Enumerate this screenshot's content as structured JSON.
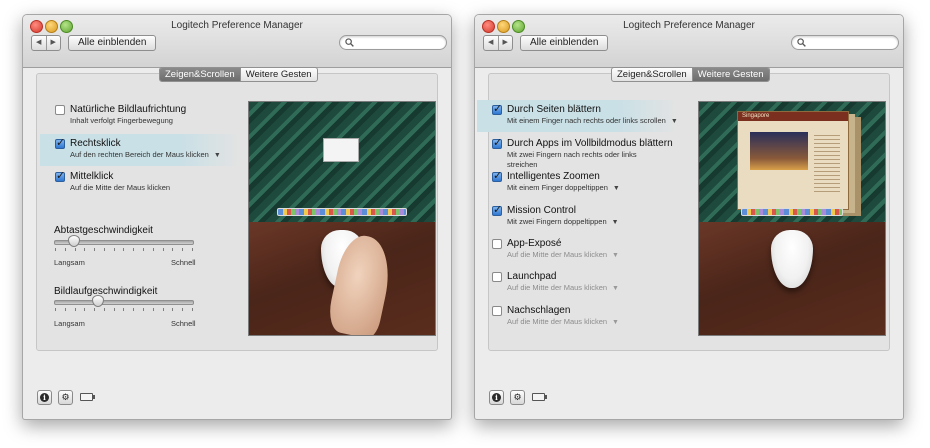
{
  "left_window": {
    "title": "Logitech Preference Manager",
    "nav": {
      "back": "◀",
      "forward": "▶"
    },
    "show_all": "Alle einblenden",
    "tabs": [
      {
        "label": "Zeigen&Scrollen",
        "selected": true
      },
      {
        "label": "Weitere Gesten",
        "selected": false
      }
    ],
    "options": [
      {
        "title": "Natürliche Bildlaufrichtung",
        "subtitle": "Inhalt verfolgt Fingerbewegung",
        "checked": false,
        "dropdown": false
      },
      {
        "title": "Rechtsklick",
        "subtitle": "Auf den rechten Bereich der Maus klicken",
        "checked": true,
        "dropdown": true,
        "highlighted": true
      },
      {
        "title": "Mittelklick",
        "subtitle": "Auf die Mitte der Maus klicken",
        "checked": true,
        "dropdown": false
      }
    ],
    "sliders": [
      {
        "title": "Abtastgeschwindigkeit",
        "min_label": "Langsam",
        "max_label": "Schnell",
        "value": 0.14
      },
      {
        "title": "Bildlaufgeschwindigkeit",
        "min_label": "Langsam",
        "max_label": "Schnell",
        "value": 0.3
      }
    ]
  },
  "right_window": {
    "title": "Logitech Preference Manager",
    "nav": {
      "back": "◀",
      "forward": "▶"
    },
    "show_all": "Alle einblenden",
    "tabs": [
      {
        "label": "Zeigen&Scrollen",
        "selected": false
      },
      {
        "label": "Weitere Gesten",
        "selected": true
      }
    ],
    "options": [
      {
        "title": "Durch Seiten blättern",
        "subtitle": "Mit einem Finger nach rechts oder links scrollen",
        "checked": true,
        "dropdown": true,
        "highlighted": true
      },
      {
        "title": "Durch Apps im Vollbildmodus blättern",
        "subtitle": "Mit zwei Fingern nach rechts oder links streichen",
        "checked": true,
        "dropdown": false
      },
      {
        "title": "Intelligentes Zoomen",
        "subtitle": "Mit einem Finger doppeltippen",
        "checked": true,
        "dropdown": true
      },
      {
        "title": "Mission Control",
        "subtitle": "Mit zwei Fingern doppeltippen",
        "checked": true,
        "dropdown": true
      },
      {
        "title": "App-Exposé",
        "subtitle": "Auf die Mitte der Maus klicken",
        "checked": false,
        "dropdown": true
      },
      {
        "title": "Launchpad",
        "subtitle": "Auf die Mitte der Maus klicken",
        "checked": false,
        "dropdown": true
      },
      {
        "title": "Nachschlagen",
        "subtitle": "Auf die Mitte der Maus klicken",
        "checked": false,
        "dropdown": true
      }
    ],
    "preview_page_title": "Singapore"
  },
  "dropdown_glyph": "▼",
  "bottom_icons": [
    "info-icon",
    "gear-icon",
    "battery-icon"
  ],
  "accent_color": "#2f77d2",
  "highlight_color": "#c9e0e6"
}
